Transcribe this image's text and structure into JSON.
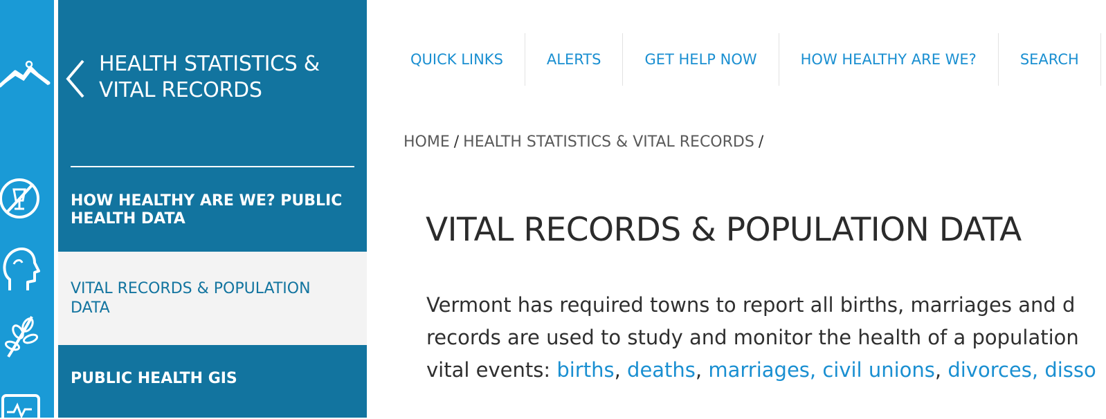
{
  "sidebar": {
    "title": "Health Statistics & Vital Records",
    "items": [
      {
        "label": "How Healthy Are We? Public Health Data",
        "active": false
      },
      {
        "label": "Vital Records & Population Data",
        "active": true
      },
      {
        "label": "Public Health GIS",
        "active": false
      }
    ]
  },
  "rail": {
    "icons": [
      "mountain-logo-icon",
      "no-alcohol-icon",
      "head-profile-icon",
      "plant-icon",
      "monitor-heartbeat-icon"
    ]
  },
  "topnav": {
    "items": [
      "Quick Links",
      "Alerts",
      "Get Help Now",
      "How Healthy Are We?",
      "Search"
    ]
  },
  "breadcrumb": {
    "home": "Home",
    "section": "Health Statistics & Vital Records",
    "separator": "/"
  },
  "page": {
    "title": "Vital Records & Population Data",
    "body": {
      "line1": "Vermont has required towns to report all births, marriages and d",
      "line2": "records are used to study and monitor the health of a population",
      "line3_prefix": "vital events: ",
      "links": [
        "births",
        "deaths",
        "marriages, civil unions",
        "divorces, disso"
      ],
      "comma": ","
    }
  },
  "colors": {
    "rail": "#1a9ad6",
    "sidebar": "#12749f",
    "active_bg": "#f3f3f3",
    "link": "#1a8fd1"
  }
}
